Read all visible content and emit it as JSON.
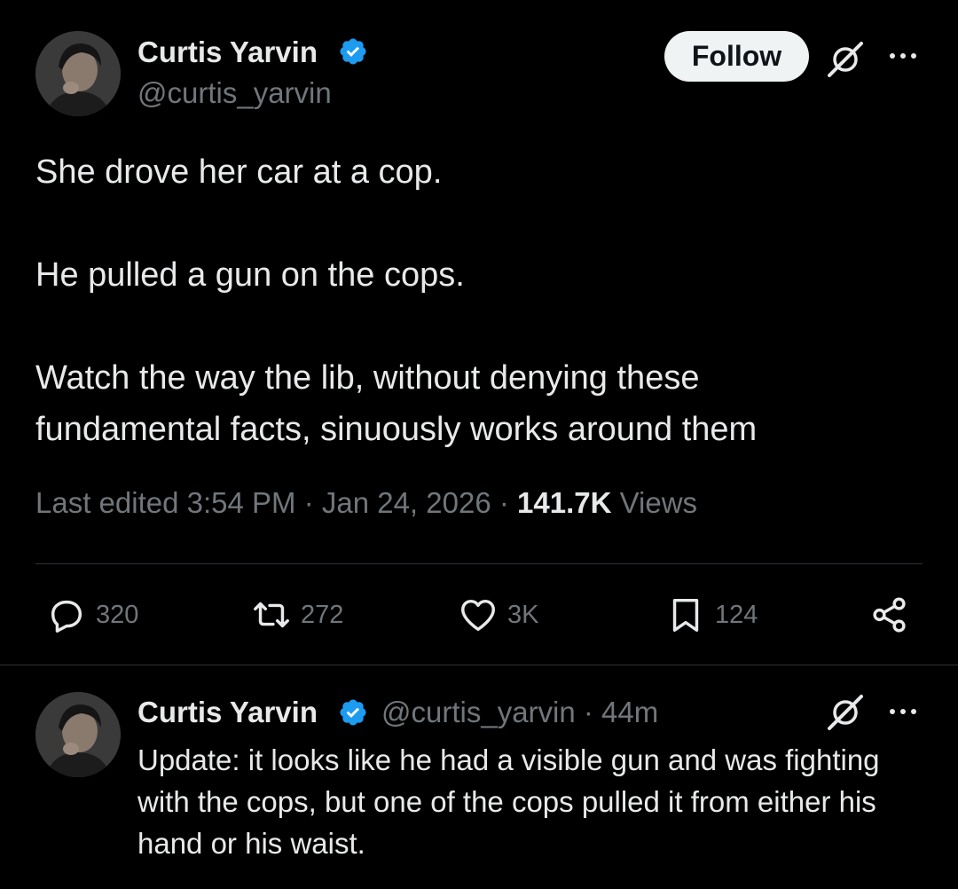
{
  "main_tweet": {
    "author_name": "Curtis Yarvin",
    "author_handle": "@curtis_yarvin",
    "follow_label": "Follow",
    "lines": [
      "She drove her car at a cop.",
      "He pulled a gun on the cops.",
      "Watch the way the lib, without denying these fundamental facts, sinuously works around them"
    ],
    "meta_prefix": "Last edited 3:54 PM · Jan 24, 2026 · ",
    "views_count": "141.7K",
    "views_label": " Views",
    "replies": "320",
    "reposts": "272",
    "likes": "3K",
    "bookmarks": "124"
  },
  "reply_tweet": {
    "author_name": "Curtis Yarvin",
    "handle_time": "@curtis_yarvin · 44m",
    "text": "Update: it looks like he had a visible gun and was fighting with the cops, but one of the cops pulled it from either his hand or his waist."
  },
  "icons": {
    "verified": "verified-badge-icon",
    "grok": "grok-icon",
    "more": "more-icon",
    "reply": "reply-icon",
    "repost": "repost-icon",
    "like": "heart-icon",
    "bookmark": "bookmark-icon",
    "share": "share-icon"
  },
  "colors": {
    "background": "#000000",
    "text": "#e7e9ea",
    "secondary": "#71767b",
    "verified": "#1d9bf0",
    "follow_bg": "#eff3f4"
  }
}
